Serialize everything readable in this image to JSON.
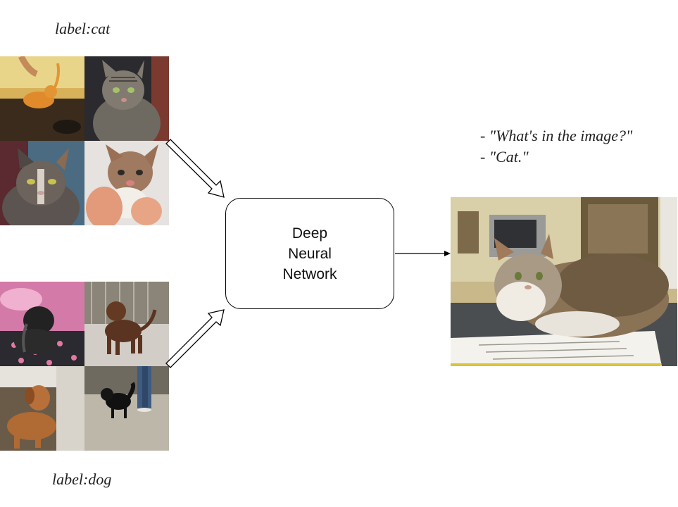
{
  "labels": {
    "cat": "label:cat",
    "dog": "label:dog"
  },
  "network": {
    "line1": "Deep",
    "line2": "Neural",
    "line3": "Network"
  },
  "dialog": {
    "question_prefix": "- ",
    "question": "\"What's in the image?\"",
    "answer_prefix": "- ",
    "answer": "\"Cat.\""
  },
  "icons": {
    "cat_tiles": [
      "orange-kitten-photo",
      "tabby-cat-photo",
      "calico-cat-photo",
      "held-kitten-photo"
    ],
    "dog_tiles": [
      "black-dog-on-pink-bed-photo",
      "brown-dog-in-kennel-photo",
      "tan-dog-lying-photo",
      "small-black-dog-photo"
    ],
    "result": "fluffy-cat-on-papers-photo"
  }
}
